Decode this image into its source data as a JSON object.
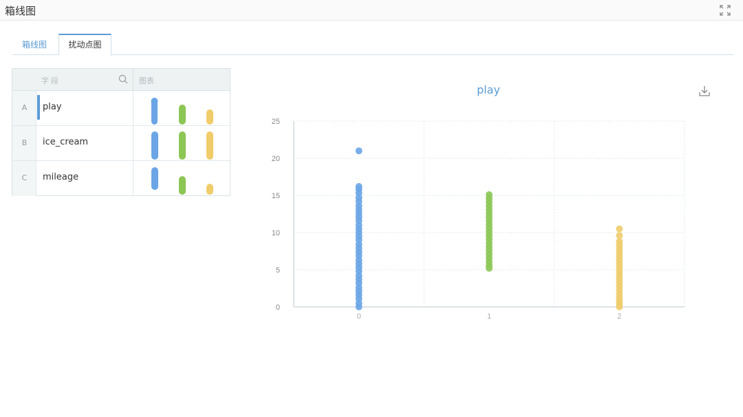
{
  "window": {
    "title": "箱线图"
  },
  "tabs": [
    {
      "label": "箱线图"
    },
    {
      "label": "扰动点图"
    }
  ],
  "fields": {
    "col_field": "字段",
    "col_chart": "图表",
    "rows": [
      {
        "index": "A",
        "name": "play"
      },
      {
        "index": "B",
        "name": "ice_cream"
      },
      {
        "index": "C",
        "name": "mileage"
      }
    ]
  },
  "colors": {
    "blue": "#6aa5e6",
    "green": "#8cc655",
    "yellow": "#f0cc6a",
    "accent": "#5b9bd5"
  },
  "chart_data": {
    "type": "scatter",
    "title": "play",
    "xlabel": "",
    "ylabel": "",
    "x_ticks": [
      "0",
      "1",
      "2"
    ],
    "ylim": [
      0,
      25
    ],
    "y_ticks": [
      0,
      5,
      10,
      15,
      20,
      25
    ],
    "grid": true,
    "series": [
      {
        "x": 0,
        "color": "#6aa5e6",
        "values": [
          21,
          16.2,
          15.8,
          15.3,
          14.7,
          14.2,
          13.6,
          13.1,
          12.6,
          12.1,
          11.6,
          11.0,
          10.5,
          10.0,
          9.5,
          9.0,
          8.4,
          7.9,
          7.4,
          6.9,
          6.3,
          5.8,
          5.3,
          4.8,
          4.2,
          3.7,
          3.2,
          2.6,
          2.1,
          1.6,
          1.1,
          0.5,
          0
        ]
      },
      {
        "x": 1,
        "color": "#8cc655",
        "values": [
          15.1,
          14.6,
          14.1,
          13.6,
          13.1,
          12.6,
          12.1,
          11.6,
          11.1,
          10.6,
          10.1,
          9.6,
          9.1,
          8.6,
          8.1,
          7.6,
          7.1,
          6.6,
          6.1,
          5.6,
          5.2
        ]
      },
      {
        "x": 2,
        "color": "#f0cc6a",
        "values": [
          10.5,
          9.6,
          8.8,
          8.3,
          7.8,
          7.3,
          6.8,
          6.3,
          5.8,
          5.3,
          4.8,
          4.3,
          3.8,
          3.3,
          2.8,
          2.3,
          1.8,
          1.3,
          0.8,
          0.4,
          0
        ]
      }
    ]
  }
}
